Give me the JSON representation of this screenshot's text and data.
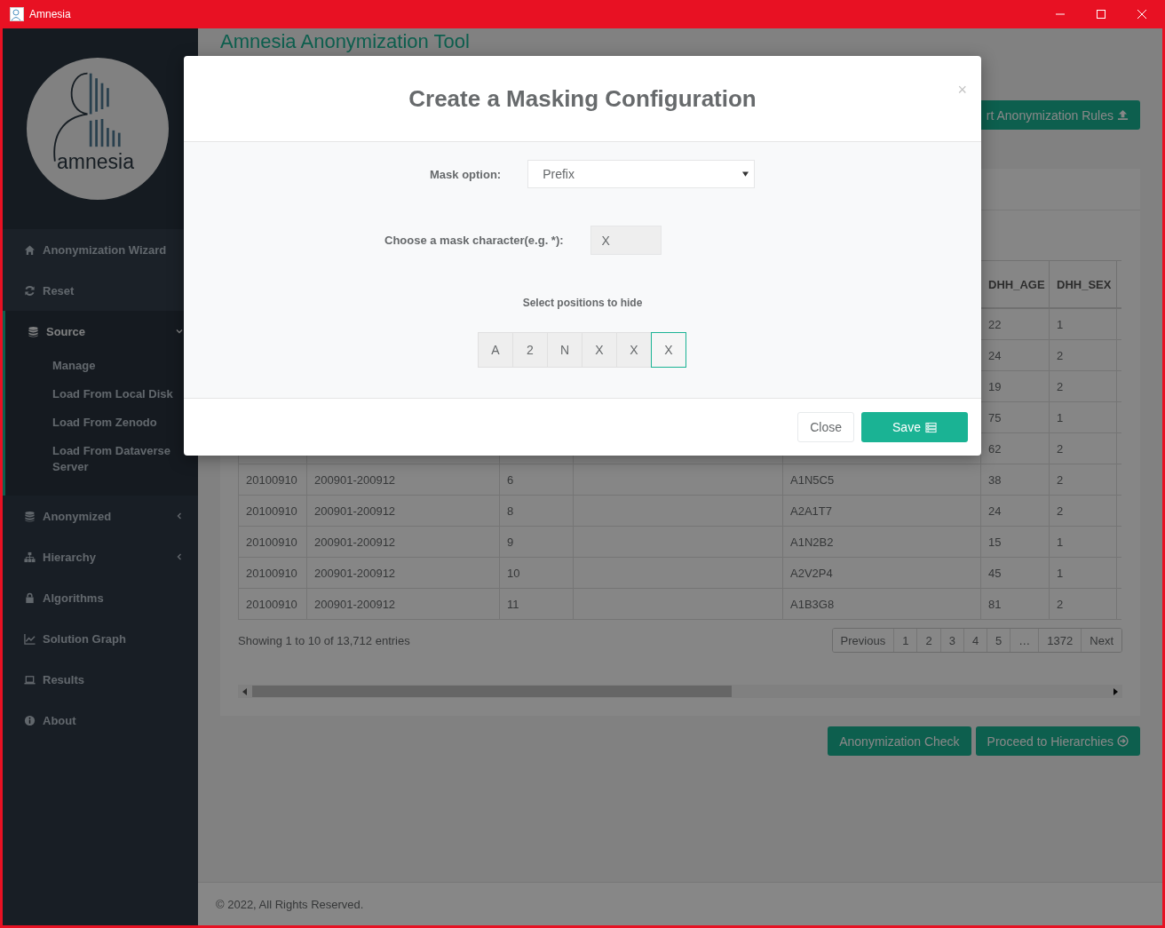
{
  "window": {
    "title": "Amnesia"
  },
  "sidebar": {
    "logo_text": "amnesia",
    "items": [
      {
        "label": "Anonymization Wizard",
        "kind": "link"
      },
      {
        "label": "Reset",
        "kind": "link"
      },
      {
        "label": "Source",
        "kind": "group",
        "expanded": true,
        "children": [
          "Manage",
          "Load From Local Disk",
          "Load From Zenodo",
          "Load From Dataverse Server"
        ]
      },
      {
        "label": "Anonymized",
        "kind": "group",
        "expanded": false
      },
      {
        "label": "Hierarchy",
        "kind": "group",
        "expanded": false
      },
      {
        "label": "Algorithms",
        "kind": "link"
      },
      {
        "label": "Solution Graph",
        "kind": "link"
      },
      {
        "label": "Results",
        "kind": "link"
      },
      {
        "label": "About",
        "kind": "link"
      }
    ]
  },
  "main": {
    "title": "Amnesia Anonymization Tool",
    "import_button": "rt Anonymization Rules",
    "table": {
      "columns": [
        "",
        "",
        "",
        "",
        "",
        "DHH_AGE",
        "DHH_SEX"
      ],
      "rows": [
        [
          "",
          "",
          "",
          "",
          "",
          "22",
          "1"
        ],
        [
          "",
          "",
          "",
          "",
          "",
          "24",
          "2"
        ],
        [
          "",
          "",
          "",
          "",
          "",
          "19",
          "2"
        ],
        [
          "",
          "",
          "",
          "",
          "",
          "75",
          "1"
        ],
        [
          "",
          "",
          "",
          "",
          "",
          "62",
          "2"
        ],
        [
          "20100910",
          "200901-200912",
          "6",
          "",
          "A1N5C5",
          "38",
          "2"
        ],
        [
          "20100910",
          "200901-200912",
          "8",
          "",
          "A2A1T7",
          "24",
          "2"
        ],
        [
          "20100910",
          "200901-200912",
          "9",
          "",
          "A1N2B2",
          "15",
          "1"
        ],
        [
          "20100910",
          "200901-200912",
          "10",
          "",
          "A2V2P4",
          "45",
          "1"
        ],
        [
          "20100910",
          "200901-200912",
          "11",
          "",
          "A1B3G8",
          "81",
          "2"
        ]
      ]
    },
    "info": "Showing 1 to 10 of 13,712 entries",
    "pagination": [
      "Previous",
      "1",
      "2",
      "3",
      "4",
      "5",
      "…",
      "1372",
      "Next"
    ],
    "buttons": [
      "Anonymization Check",
      "Proceed to Hierarchies"
    ]
  },
  "footer": "© 2022, All Rights Reserved.",
  "modal": {
    "title": "Create a Masking Configuration",
    "close": "×",
    "mask_option": {
      "label": "Mask option:",
      "value": "Prefix"
    },
    "mask_character": {
      "label": "Choose a mask character(e.g. *):",
      "value": "X"
    },
    "positions_label": "Select positions to hide",
    "positions": [
      {
        "char": "A",
        "selected": false
      },
      {
        "char": "2",
        "selected": false
      },
      {
        "char": "N",
        "selected": false
      },
      {
        "char": "X",
        "selected": false
      },
      {
        "char": "X",
        "selected": false
      },
      {
        "char": "X",
        "selected": true
      }
    ],
    "buttons": [
      "Close",
      "Save"
    ]
  }
}
